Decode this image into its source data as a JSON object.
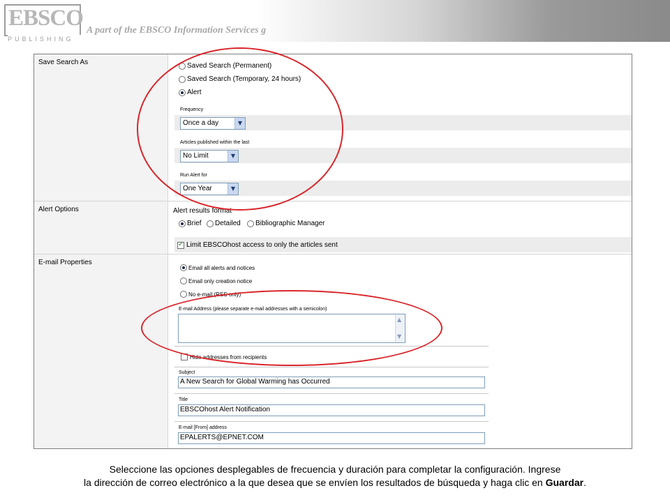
{
  "header": {
    "logo_main": "EBSCO",
    "logo_sub": "PUBLISHING",
    "tagline": "A part of the EBSCO Information Services g"
  },
  "save_search": {
    "label": "Save Search As",
    "options": [
      "Saved Search (Permanent)",
      "Saved Search (Temporary, 24 hours)",
      "Alert"
    ],
    "selected": "Alert",
    "frequency_label": "Frequency",
    "frequency_value": "Once a day",
    "articles_label": "Articles published within the last",
    "articles_value": "No Limit",
    "run_label": "Run Alert for",
    "run_value": "One Year"
  },
  "alert_options": {
    "label": "Alert Options",
    "format_label": "Alert results format",
    "formats": [
      "Brief",
      "Detailed",
      "Bibliographic Manager"
    ],
    "selected_format": "Brief",
    "limit_label": "Limit EBSCOhost access to only the articles sent",
    "limit_checked": true
  },
  "email_properties": {
    "label": "E-mail Properties",
    "options": [
      "Email all alerts and notices",
      "Email only creation notice",
      "No e-mail (RSS only)"
    ],
    "selected": "Email all alerts and notices",
    "address_label": "E-mail Address (please separate e-mail addresses with a semicolon)",
    "address_value": "",
    "hide_label": "Hide addresses from recipients",
    "subject_label": "Subject",
    "subject_value": "A New Search for Global Warming has Occurred",
    "title_label": "Title",
    "title_value": "EBSCOhost Alert Notification",
    "from_label": "E-mail [From] address",
    "from_value": "EPALERTS@EPNET.COM"
  },
  "caption": {
    "line1": "Seleccione las opciones desplegables de frecuencia y duración para completar la configuración. Ingrese",
    "line2": "la dirección de correo electrónico a la que desea que se envíen los resultados de búsqueda y haga clic en",
    "line2_bold": "Guardar",
    "line2_end": "."
  },
  "colors": {
    "highlight_ellipse": "#d9262b",
    "select_border": "#7f9db9"
  }
}
